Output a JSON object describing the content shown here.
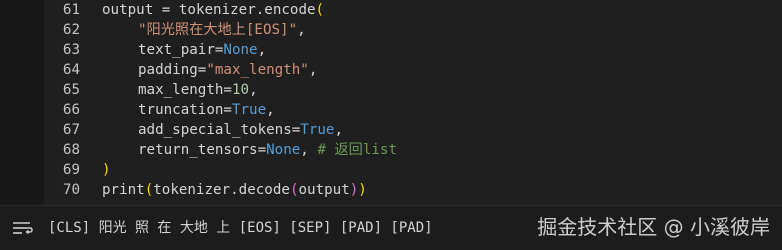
{
  "editor": {
    "lines": [
      {
        "num": "61",
        "segments": [
          {
            "t": "output = tokenizer.encode",
            "c": "def"
          },
          {
            "t": "(",
            "c": "br1"
          }
        ]
      },
      {
        "num": "62",
        "indent": true,
        "segments": [
          {
            "t": "\"阳光照在大地上[EOS]\"",
            "c": "str"
          },
          {
            "t": ",",
            "c": "def"
          }
        ]
      },
      {
        "num": "63",
        "indent": true,
        "segments": [
          {
            "t": "text_pair=",
            "c": "def"
          },
          {
            "t": "None",
            "c": "kw"
          },
          {
            "t": ",",
            "c": "def"
          }
        ]
      },
      {
        "num": "64",
        "indent": true,
        "segments": [
          {
            "t": "padding=",
            "c": "def"
          },
          {
            "t": "\"max_length\"",
            "c": "str"
          },
          {
            "t": ",",
            "c": "def"
          }
        ]
      },
      {
        "num": "65",
        "indent": true,
        "segments": [
          {
            "t": "max_length=",
            "c": "def"
          },
          {
            "t": "10",
            "c": "num"
          },
          {
            "t": ",",
            "c": "def"
          }
        ]
      },
      {
        "num": "66",
        "indent": true,
        "segments": [
          {
            "t": "truncation=",
            "c": "def"
          },
          {
            "t": "True",
            "c": "kw"
          },
          {
            "t": ",",
            "c": "def"
          }
        ]
      },
      {
        "num": "67",
        "indent": true,
        "segments": [
          {
            "t": "add_special_tokens=",
            "c": "def"
          },
          {
            "t": "True",
            "c": "kw"
          },
          {
            "t": ",",
            "c": "def"
          }
        ]
      },
      {
        "num": "68",
        "indent": true,
        "segments": [
          {
            "t": "return_tensors=",
            "c": "def"
          },
          {
            "t": "None",
            "c": "kw"
          },
          {
            "t": ", ",
            "c": "def"
          },
          {
            "t": "# 返回list",
            "c": "cmt"
          }
        ]
      },
      {
        "num": "69",
        "segments": [
          {
            "t": ")",
            "c": "br1"
          }
        ]
      },
      {
        "num": "70",
        "segments": [
          {
            "t": "print",
            "c": "def"
          },
          {
            "t": "(",
            "c": "br1"
          },
          {
            "t": "tokenizer.decode",
            "c": "def"
          },
          {
            "t": "(",
            "c": "br2"
          },
          {
            "t": "output",
            "c": "def"
          },
          {
            "t": ")",
            "c": "br2"
          },
          {
            "t": ")",
            "c": "br1"
          }
        ]
      }
    ]
  },
  "output": {
    "icon": "output-lines-icon",
    "text": "[CLS] 阳光 照 在 大地 上 [EOS] [SEP] [PAD] [PAD]"
  },
  "watermark": {
    "text": "掘金技术社区 @ 小溪彼岸"
  },
  "colors": {
    "def": "#d4d4d4",
    "str": "#ce9178",
    "kw": "#569cd6",
    "num": "#b5cea8",
    "br1": "#ffd700",
    "br2": "#da70d6",
    "cmt": "#6a9955",
    "background": "#1e1e1e"
  }
}
